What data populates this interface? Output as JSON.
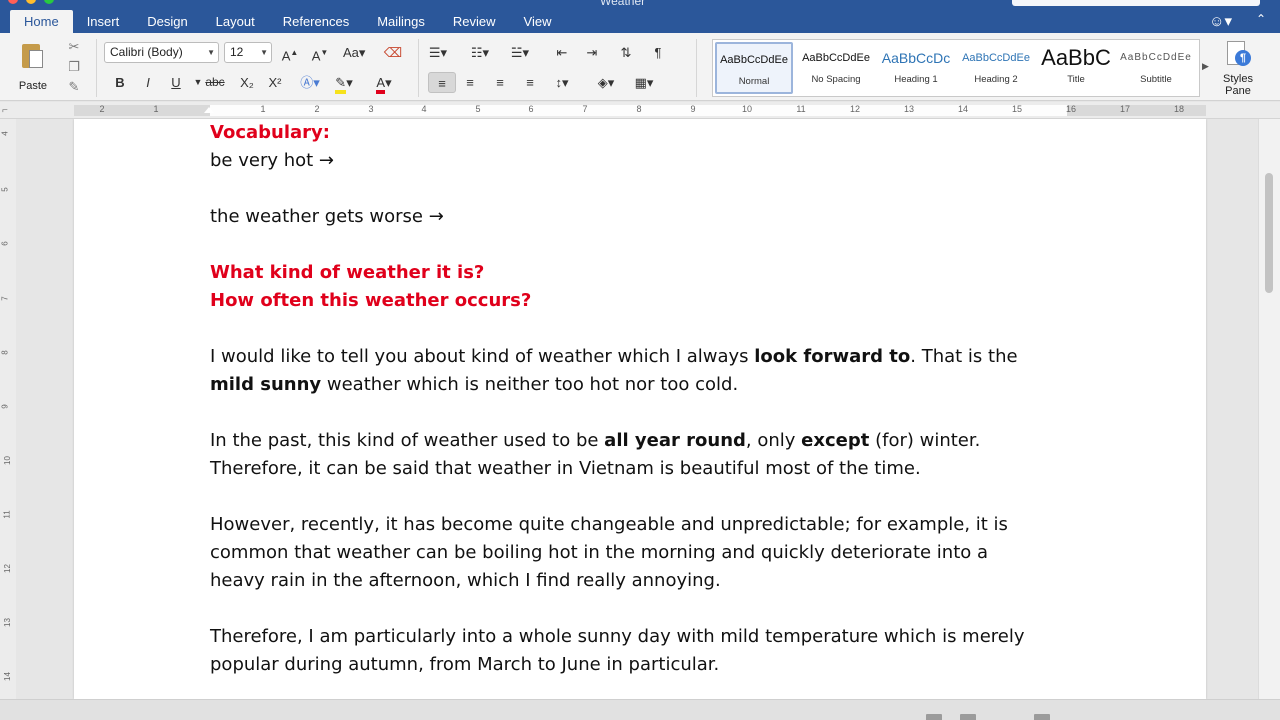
{
  "window": {
    "doc_title": "Weather"
  },
  "tabs": [
    {
      "label": "Home",
      "active": true
    },
    {
      "label": "Insert"
    },
    {
      "label": "Design"
    },
    {
      "label": "Layout"
    },
    {
      "label": "References"
    },
    {
      "label": "Mailings"
    },
    {
      "label": "Review"
    },
    {
      "label": "View"
    }
  ],
  "ribbon": {
    "paste_label": "Paste",
    "font_name": "Calibri (Body)",
    "font_size": "12",
    "styles": [
      {
        "sample": "AaBbCcDdEe",
        "name": "Normal"
      },
      {
        "sample": "AaBbCcDdEe",
        "name": "No Spacing"
      },
      {
        "sample": "AaBbCcDc",
        "name": "Heading 1"
      },
      {
        "sample": "AaBbCcDdEe",
        "name": "Heading 2"
      },
      {
        "sample": "AaBbC",
        "name": "Title"
      },
      {
        "sample": "AaBbCcDdEe",
        "name": "Subtitle"
      }
    ],
    "styles_pane_line1": "Styles",
    "styles_pane_line2": "Pane",
    "bold": "B",
    "italic": "I",
    "underline": "U",
    "strike": "abc",
    "sub": "X₂",
    "sup": "X²"
  },
  "ruler": {
    "labels": [
      "2",
      "1",
      "1",
      "2",
      "3",
      "4",
      "5",
      "6",
      "7",
      "8",
      "9",
      "10",
      "11",
      "12",
      "13",
      "14",
      "15",
      "16",
      "17",
      "18"
    ],
    "v_labels": [
      "4",
      "5",
      "6",
      "7",
      "8",
      "9",
      "10",
      "11",
      "12",
      "13",
      "14"
    ]
  },
  "document": {
    "vocab_heading": "Vocabulary:",
    "vocab_1": "be very hot →",
    "vocab_2": "the weather gets worse →",
    "q1": "What kind of weather it is?",
    "q2": "How often this weather occurs?",
    "p1_a": "I would like to tell you about kind of weather which I always ",
    "p1_b": "look forward to",
    "p1_c": ". That is the",
    "p1_d": "mild sunny",
    "p1_e": " weather which is neither too hot nor too cold.",
    "p2_a": "In the past, this kind of weather used to be ",
    "p2_b": "all year round",
    "p2_c": ", only ",
    "p2_d": "except",
    "p2_e": " (for) winter.",
    "p2_f": "Therefore, it can be said that weather in Vietnam is beautiful most of the time.",
    "p3_1": "However, recently, it has become quite changeable and unpredictable; for example, it is",
    "p3_2": "common that weather can be boiling hot in the morning and quickly deteriorate into a",
    "p3_3": "heavy rain in the afternoon, which I find really annoying.",
    "p4_1": "Therefore, I am particularly into a whole sunny day with mild temperature which is merely",
    "p4_2": "popular during autumn, from March to June in particular."
  },
  "colors": {
    "ribbon_blue": "#2b579a",
    "heading_red": "#e0001b"
  }
}
